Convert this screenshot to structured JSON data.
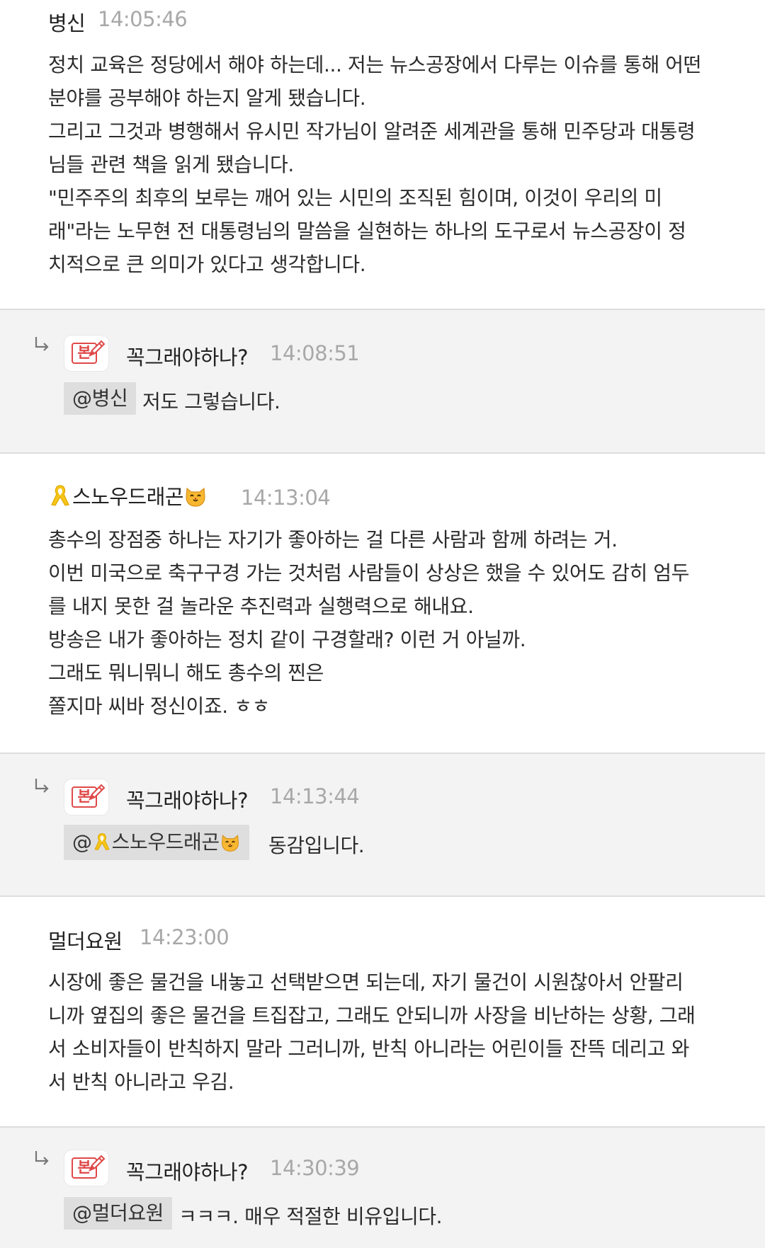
{
  "comments": [
    {
      "author": "병신",
      "time": "14:05:46",
      "lines": [
        "정치 교육은 정당에서 해야 하는데... 저는 뉴스공장에서 다루는 이슈를 통해 어떤",
        "분야를 공부해야 하는지 알게 됐습니다.",
        "그리고 그것과 병행해서 유시민 작가님이 알려준 세계관을 통해 민주당과 대통령",
        "님들 관련 책을 읽게 됐습니다.",
        "\"민주주의 최후의 보루는 깨어 있는 시민의 조직된 힘이며, 이것이 우리의 미",
        "래\"라는 노무현 전 대통령님의 말씀을 실현하는 하나의 도구로서 뉴스공장이 정",
        "치적으로 큰 의미가 있다고 생각합니다."
      ]
    },
    {
      "author": "스노우드래곤",
      "time": "14:13:04",
      "lines": [
        "총수의 장점중 하나는 자기가 좋아하는 걸 다른 사람과 함께 하려는 거.",
        "이번 미국으로 축구구경 가는 것처럼 사람들이 상상은 했을 수 있어도 감히 엄두",
        "를 내지 못한 걸 놀라운 추진력과 실행력으로 해내요.",
        "방송은 내가 좋아하는 정치 같이 구경할래? 이런 거 아닐까.",
        "그래도 뭐니뭐니 해도 총수의 찐은",
        "쫄지마 씨바 정신이죠. ㅎㅎ"
      ]
    },
    {
      "author": "멀더요원",
      "time": "14:23:00",
      "lines": [
        "시장에 좋은 물건을 내놓고 선택받으면 되는데, 자기 물건이 시원찮아서 안팔리",
        "니까 옆집의 좋은 물건을 트집잡고, 그래도 안되니까 사장을 비난하는 상황, 그래",
        "서 소비자들이 반칙하지 말라 그러니까, 반칙 아니라는 어린이들 잔뜩 데리고 와",
        "서 반칙 아니라고 우김."
      ]
    }
  ],
  "replies": [
    {
      "author": "꼭그래야하나?",
      "time": "14:08:51",
      "badge": "본",
      "mention": "@병신",
      "text": "저도 그렇습니다."
    },
    {
      "author": "꼭그래야하나?",
      "time": "14:13:44",
      "badge": "본",
      "mention_prefix": "@",
      "mention_name": "스노우드래곤",
      "text": "동감입니다."
    },
    {
      "author": "꼭그래야하나?",
      "time": "14:30:39",
      "badge": "본",
      "mention": "@멀더요원",
      "text": "ㅋㅋㅋ. 매우 적절한 비유입니다."
    }
  ],
  "icons": {
    "reply": "reply-arrow-icon",
    "badge": "edit-badge-icon",
    "ribbon": "yellow-ribbon-icon",
    "cat": "cat-face-icon"
  },
  "colors": {
    "badge_red": "#e04848",
    "reply_bg": "#f3f3f3",
    "mention_bg": "#dedede",
    "time": "#a8a8a8",
    "ribbon": "#f5c518"
  }
}
